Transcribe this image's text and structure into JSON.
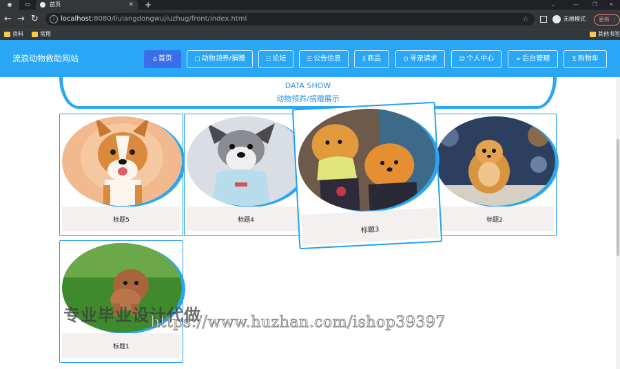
{
  "browser": {
    "tabs": [
      {
        "label": ""
      },
      {
        "label": ""
      },
      {
        "label": "首页"
      }
    ],
    "url_host": "localhost",
    "url_rest": ":8080/liulangdongwujiuzhug/front/index.html",
    "profile_label": "无痕模式",
    "update_label": "更新",
    "bookmarks": [
      "资料",
      "常用"
    ],
    "other_bookmarks": "其他书签"
  },
  "site": {
    "title": "流浪动物救助网站",
    "nav": [
      {
        "label": "首页",
        "icon": "home-icon"
      },
      {
        "label": "动物领养/捐赠",
        "icon": "adopt-icon"
      },
      {
        "label": "论坛",
        "icon": "forum-icon"
      },
      {
        "label": "公告信息",
        "icon": "notice-icon"
      },
      {
        "label": "商品",
        "icon": "goods-icon"
      },
      {
        "label": "寻宠请求",
        "icon": "search-pet-icon"
      },
      {
        "label": "个人中心",
        "icon": "user-icon"
      },
      {
        "label": "后台管理",
        "icon": "link-icon"
      },
      {
        "label": "购物车",
        "icon": "cart-icon"
      }
    ]
  },
  "banner": {
    "en": "DATA SHOW",
    "zh": "动物领养/捐赠展示"
  },
  "cards": [
    {
      "caption": "标题5",
      "image": "corgi-photo"
    },
    {
      "caption": "标题4",
      "image": "schnauzer-photo"
    },
    {
      "caption": "标题3",
      "image": "pomeranian-photo"
    },
    {
      "caption": "标题2",
      "image": "pomeranian-sitting-photo"
    },
    {
      "caption": "标题1",
      "image": "poodle-grass-photo"
    }
  ],
  "watermark": {
    "cn": "专业毕业设计代做",
    "url": "https://www.huzhan.com/ishop39397"
  }
}
